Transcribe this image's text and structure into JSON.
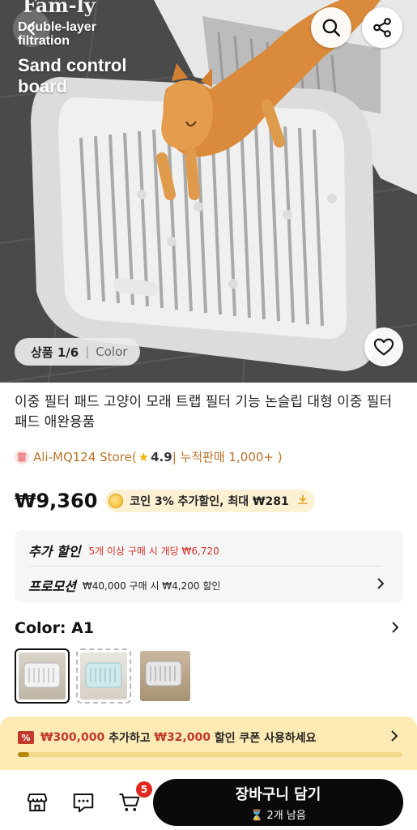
{
  "hero": {
    "brand": "Fam-ly",
    "subtitle": "Double-layer filtration",
    "title": "Sand control board",
    "counter": "상품 1/6",
    "counter_label": "Color"
  },
  "product": {
    "title": "이중 필터 패드 고양이 모래 트랩 필터 기능 논슬립 대형 이중 필터 패드 애완용품"
  },
  "store": {
    "name": "Ali-MQ124 Store",
    "open_paren": " (",
    "rating": "4.9",
    "sales": " | 누적판매 1,000+ )"
  },
  "price": {
    "amount": "₩9,360",
    "coin_text": "코인 3% 추가할인, 최대 ₩281"
  },
  "promo": {
    "extra_label": "추가 할인",
    "extra_value": "5개 이상 구매 시 개당 ₩6,720",
    "promotion_label": "프로모션",
    "promotion_value": "₩40,000 구매 시 ₩4,200 할인"
  },
  "color": {
    "label": "Color: A1"
  },
  "coupon": {
    "amount1": "₩300,000",
    "text1": " 추가하고 ",
    "amount2": "₩32,000",
    "text2": " 할인 쿠폰 사용하세요",
    "progress": 0.03
  },
  "bottom": {
    "cart_badge": "5",
    "cart_button": "장바구니 담기",
    "stock_left": "2개 남음"
  },
  "colors": {
    "accent": "#b8742a",
    "discount_red": "#d8322a",
    "coupon_bg": "#fdeab4",
    "badge_red": "#e0281f"
  }
}
